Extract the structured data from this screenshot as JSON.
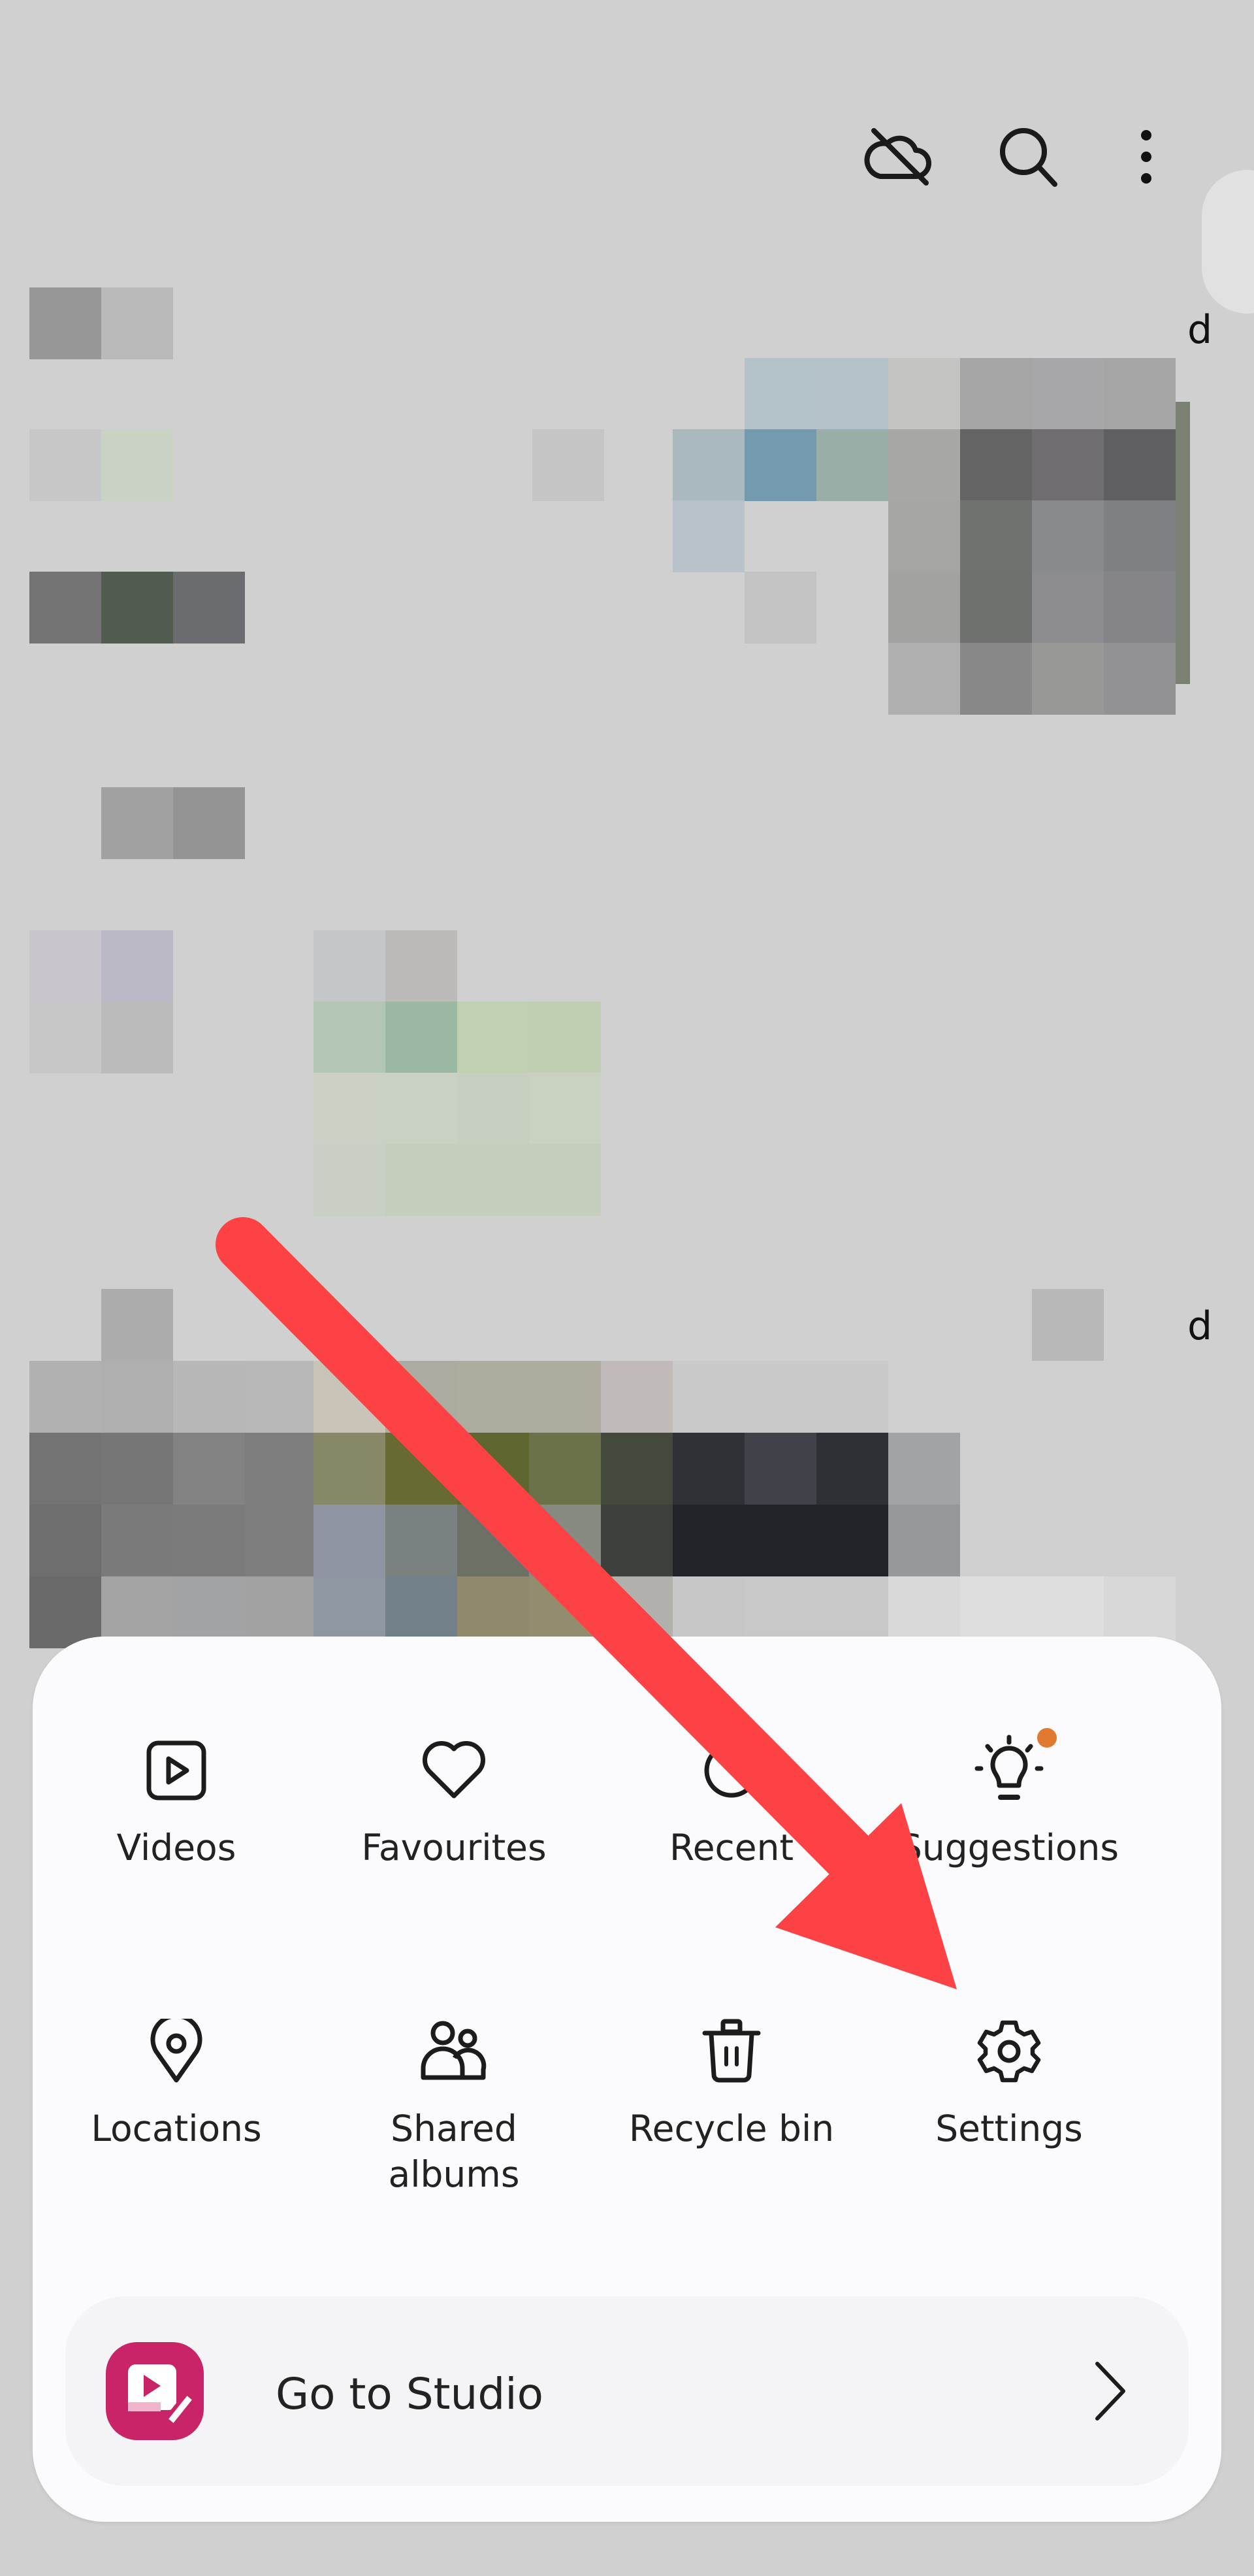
{
  "toolbar": {
    "icons": [
      {
        "name": "cloud-off-icon",
        "label": "Cloud sync off"
      },
      {
        "name": "search-icon",
        "label": "Search"
      },
      {
        "name": "more-options-icon",
        "label": "More options"
      }
    ]
  },
  "background": {
    "partial_labels": [
      "d",
      "d"
    ]
  },
  "menu": {
    "row1": [
      {
        "label": "Videos",
        "icon": "video-icon"
      },
      {
        "label": "Favourites",
        "icon": "heart-icon"
      },
      {
        "label": "Recent",
        "icon": "recent-icon"
      },
      {
        "label": "Suggestions",
        "icon": "lightbulb-icon",
        "badge": true
      }
    ],
    "row2": [
      {
        "label": "Locations",
        "icon": "location-pin-icon"
      },
      {
        "label": "Shared albums",
        "icon": "shared-people-icon"
      },
      {
        "label": "Recycle bin",
        "icon": "trash-icon"
      },
      {
        "label": "Settings",
        "icon": "gear-icon"
      }
    ],
    "studio": {
      "label": "Go to Studio",
      "icon": "studio-app-icon"
    }
  },
  "colors": {
    "annotation_arrow": "#fc4244",
    "badge": "#e07a30",
    "studio_brand": "#c82467"
  },
  "annotation": {
    "type": "arrow",
    "points_to": "Settings"
  }
}
